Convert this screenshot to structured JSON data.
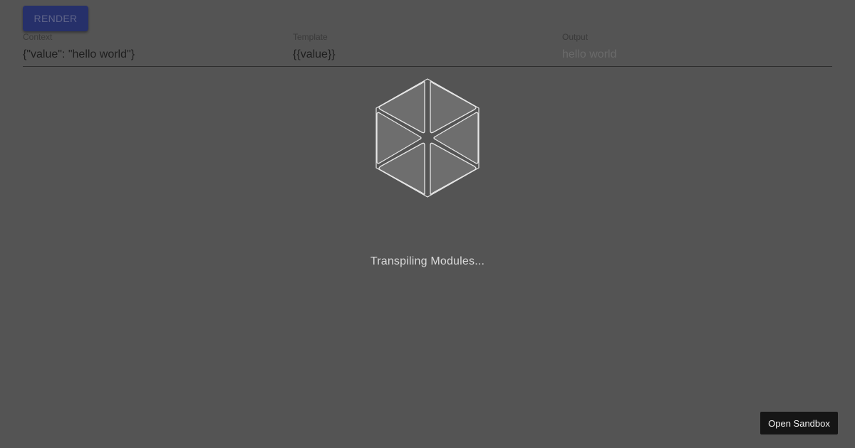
{
  "toolbar": {
    "render_label": "RENDER"
  },
  "fields": {
    "context": {
      "label": "Context",
      "value": "{\"value\": \"hello world\"}"
    },
    "template": {
      "label": "Template",
      "value": "{{value}}"
    },
    "output": {
      "label": "Output",
      "value": "hello world"
    }
  },
  "loader": {
    "icon": "codesandbox-cube-icon",
    "status": "Transpiling Modules..."
  },
  "footer": {
    "open_sandbox_label": "Open Sandbox"
  },
  "colors": {
    "overlay_background": "#545454",
    "render_button": "#26306a",
    "sandbox_button": "#151515"
  }
}
